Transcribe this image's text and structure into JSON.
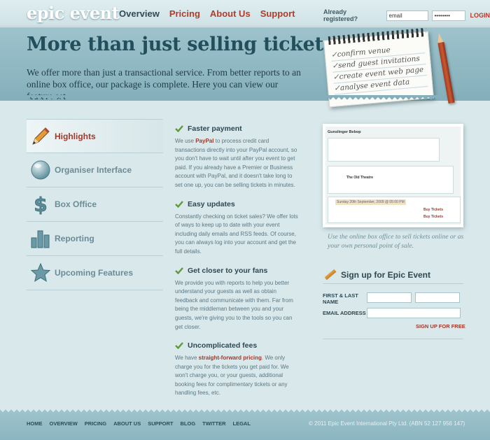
{
  "brand": {
    "logo_text": "epic event"
  },
  "nav": {
    "items": [
      {
        "label": "Overview",
        "active": true
      },
      {
        "label": "Pricing",
        "active": false
      },
      {
        "label": "About Us",
        "active": false
      },
      {
        "label": "Support",
        "active": false
      }
    ]
  },
  "login": {
    "label": "Already registered?",
    "email_value": "email",
    "password_value": "••••••••",
    "button_label": "LOGIN"
  },
  "hero": {
    "title": "More than just selling tickets.",
    "subtitle": "We offer more than just a transactional service. From better reports to an online box office, our package is complete. Here you can view our feature set.",
    "notepad_items": [
      "confirm venue",
      "send guest invitations",
      "create event web page",
      "analyse event data"
    ]
  },
  "sidebar": {
    "items": [
      {
        "label": "Highlights",
        "icon": "pencil-icon",
        "active": true
      },
      {
        "label": "Organiser Interface",
        "icon": "globe-icon",
        "active": false
      },
      {
        "label": "Box Office",
        "icon": "dollar-icon",
        "active": false
      },
      {
        "label": "Reporting",
        "icon": "bar-chart-icon",
        "active": false
      },
      {
        "label": "Upcoming Features",
        "icon": "star-icon",
        "active": false
      }
    ]
  },
  "features": {
    "faster_payment": {
      "title": "Faster payment",
      "pre": "We use ",
      "highlight": "PayPal",
      "post": " to process credit card transactions directly into your PayPal account, so you don't have to wait until after you event to get paid. If you already have a Premier or Business account with PayPal, and it doesn't take long to set one up, you can be selling tickets in minutes."
    },
    "easy_updates": {
      "title": "Easy updates",
      "body": "Constantly checking on ticket sales? We offer lots of ways to keep up to date with your event including daily emails and RSS feeds. Of course, you can always log into your account and get the full details."
    },
    "closer_to_fans": {
      "title": "Get closer to your fans",
      "body": "We provide you with reports to help you better understand your guests as well as obtain feedback and communicate with them. Far from being the middleman between you and your guests, we're giving you to the tools so you can get closer."
    },
    "uncomplicated_fees": {
      "title": "Uncomplicated fees",
      "pre": "We have ",
      "highlight": "straight-forward pricing",
      "post": ". We only charge you for the tickets you get paid for. We won't charge you, or your guests, additional booking fees for complimentary tickets or any handling fees, etc."
    }
  },
  "preview": {
    "user_name": "Gunslinger Bebop",
    "venue_name": "The Old Theatre",
    "session": "Sunday 20th September, 2009 @ 05:00 PM",
    "buy_label": "Buy Tickets",
    "caption": "Use the online box office to sell tickets online or as your own personal point of sale."
  },
  "signup": {
    "title": "Sign up for Epic Event",
    "name_label": "FIRST & LAST NAME",
    "email_label": "EMAIL ADDRESS",
    "first_value": "",
    "last_value": "",
    "email_value": "",
    "button_label": "SIGN UP FOR FREE"
  },
  "footer": {
    "links": [
      "HOME",
      "OVERVIEW",
      "PRICING",
      "ABOUT US",
      "SUPPORT",
      "BLOG",
      "TWITTER",
      "LEGAL"
    ],
    "copyright": "© 2011 Epic Event International Pty Ltd. (ABN 52 127 956 147)"
  },
  "colors": {
    "accent_red": "#b33b2a",
    "dark_teal": "#234e5c",
    "hero_bg": "#9ec3cc",
    "body_bg": "#d9e8ea",
    "check_green": "#5f9a3a"
  }
}
